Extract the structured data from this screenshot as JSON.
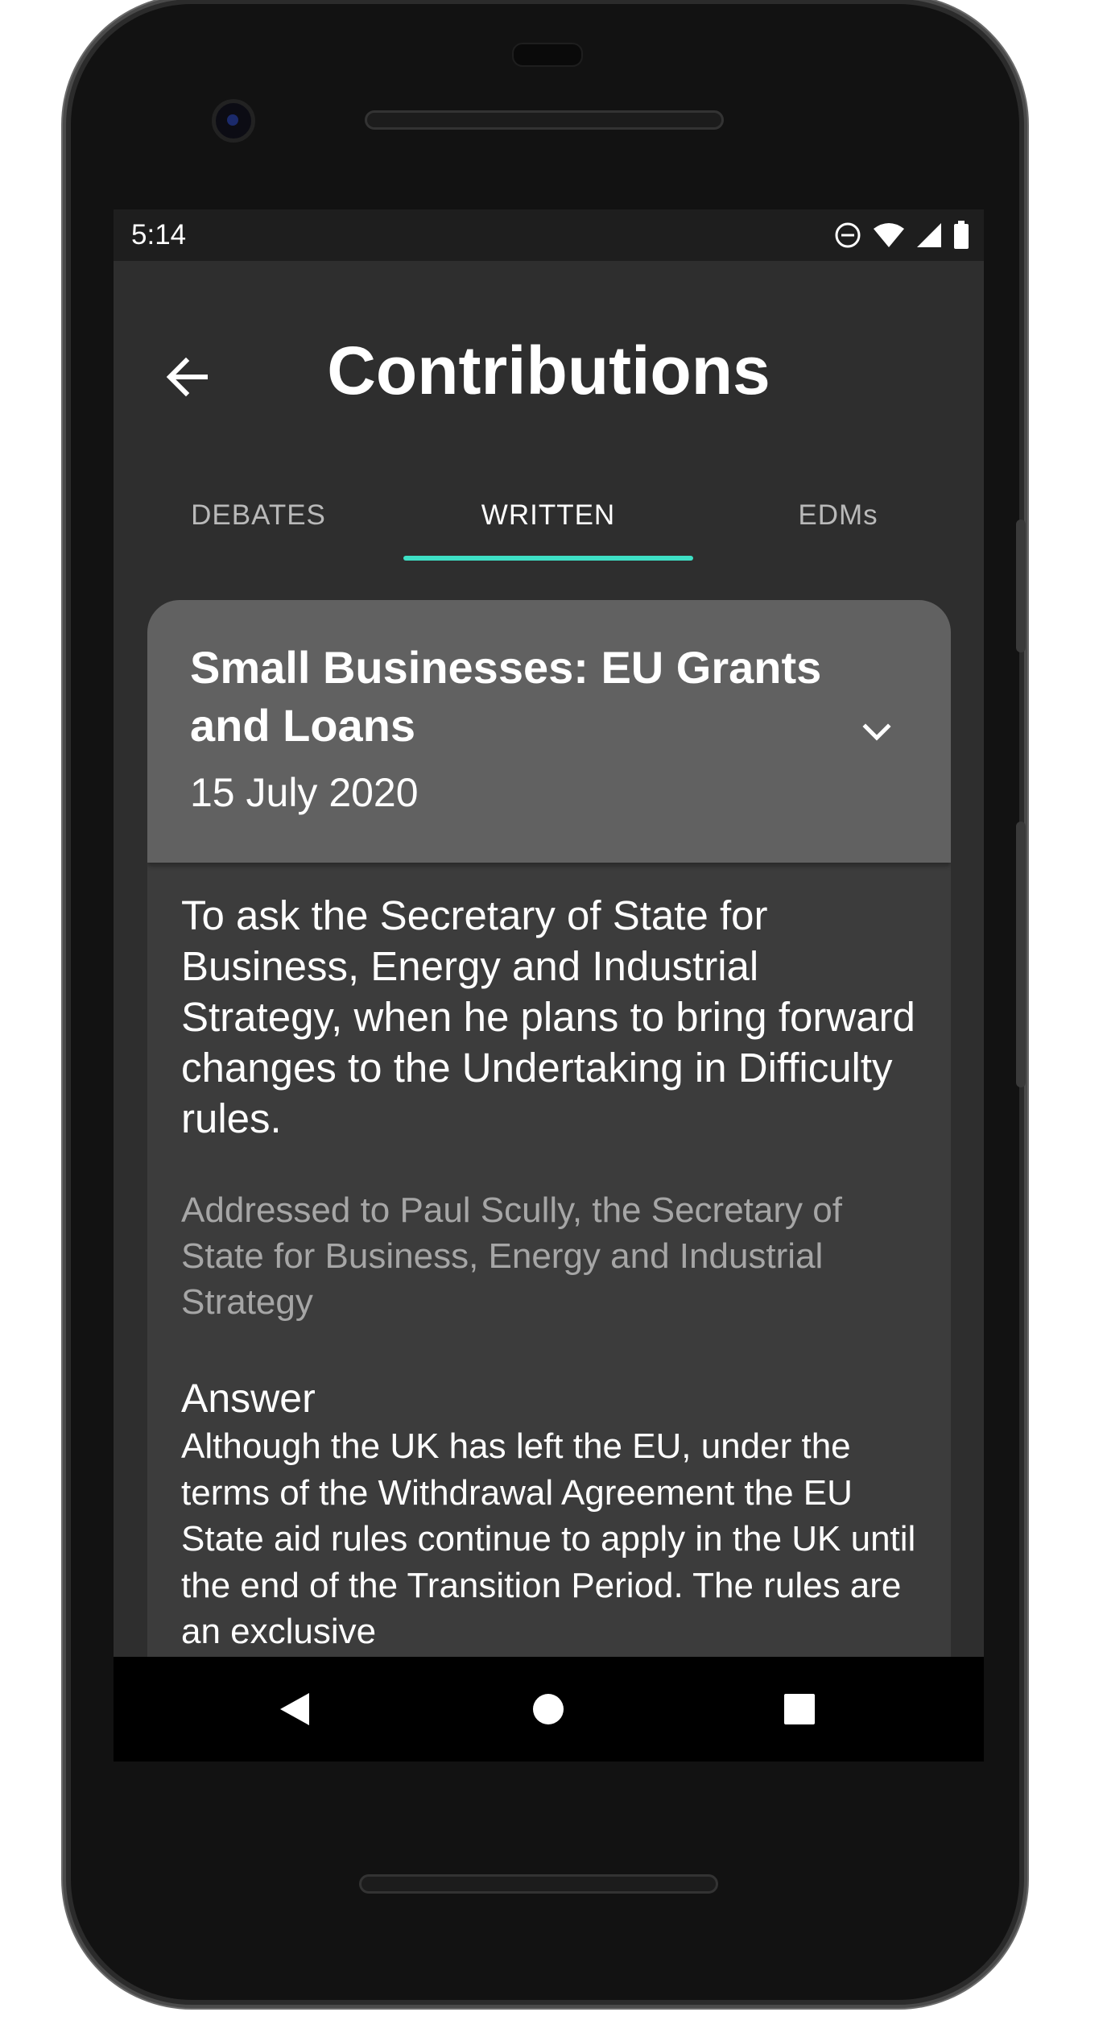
{
  "status_bar": {
    "time": "5:14",
    "icons": [
      "do-not-disturb-icon",
      "wifi-icon",
      "signal-icon",
      "battery-icon"
    ]
  },
  "app_bar": {
    "title": "Contributions",
    "back_icon": "arrow-left-icon"
  },
  "tabs": [
    {
      "label": "DEBATES",
      "active": false
    },
    {
      "label": "WRITTEN",
      "active": true
    },
    {
      "label": "EDMs",
      "active": false
    }
  ],
  "card": {
    "title": "Small Businesses: EU Grants and Loans",
    "date": "15 July 2020",
    "expand_icon": "chevron-down-icon",
    "question": "To ask the Secretary of State for Business, Energy and Industrial Strategy, when he plans to bring forward changes to the Undertaking in Difficulty rules.",
    "addressed_to": "Addressed to Paul Scully, the Secretary of State for Business, Energy and Industrial Strategy",
    "answer_heading": "Answer",
    "answer_text": "Although the UK has left the EU, under the terms of the Withdrawal Agreement the EU State aid rules continue to apply in the UK until the end of the Transition Period. The rules are an exclusive"
  },
  "nav_bar": {
    "back_icon": "triangle-back-icon",
    "home_icon": "circle-home-icon",
    "recents_icon": "square-recents-icon"
  },
  "colors": {
    "accent": "#3ee0c5",
    "screen_bg": "#2e2e2e",
    "card_header_bg": "#616161",
    "card_body_bg": "#3c3c3c"
  }
}
